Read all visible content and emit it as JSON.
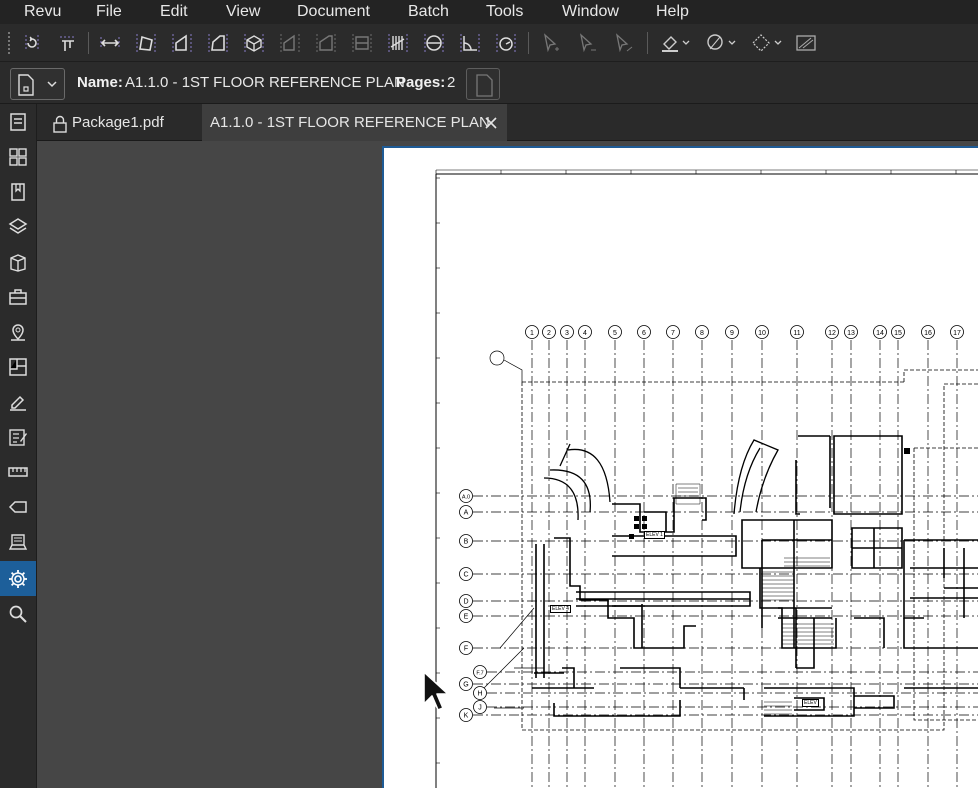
{
  "menu": [
    "Revu",
    "File",
    "Edit",
    "View",
    "Document",
    "Batch",
    "Tools",
    "Window",
    "Help"
  ],
  "toolbar_icons": [
    "rotate-icon",
    "align-icon",
    "length-measure-icon",
    "polylength-icon",
    "area-icon",
    "perimeter-icon",
    "volume-icon",
    "diameter-icon",
    "dynamic-fill-icon",
    "cutout-icon",
    "count-icon",
    "radius-icon",
    "angle-icon",
    "arc-icon",
    "select-markup-icon",
    "line-markup-icon",
    "pen-markup-icon",
    "fill-color-icon",
    "shape-style-icon",
    "hatch-pattern-icon",
    "opacity-icon"
  ],
  "properties": {
    "name_label": "Name:",
    "name_value": "A1.1.0 - 1ST FLOOR REFERENCE PLAN",
    "pages_label": "Pages:",
    "pages_value": "2"
  },
  "tabs": [
    {
      "label": "Package1.pdf",
      "locked": true
    },
    {
      "label": "A1.1.0 - 1ST FLOOR REFERENCE PLAN",
      "closable": true
    }
  ],
  "sidebar_icons": [
    "file-access-icon",
    "thumbnails-icon",
    "bookmarks-icon",
    "layers-icon",
    "spaces-icon",
    "tool-chest-icon",
    "places-icon",
    "sheet-list-icon",
    "signatures-icon",
    "markups-list-icon",
    "measurements-icon",
    "tags-icon",
    "studio-icon",
    "properties-icon",
    "search-icon"
  ],
  "active_sidebar": "properties-icon",
  "drawing": {
    "column_grid": [
      "1",
      "2",
      "3",
      "4",
      "5",
      "6",
      "7",
      "8",
      "9",
      "10",
      "11",
      "12",
      "13",
      "14",
      "15",
      "16",
      "17"
    ],
    "row_grid": [
      "A.0",
      "A",
      "B",
      "C",
      "D",
      "E",
      "F",
      "F.7",
      "G",
      "H",
      "J",
      "K"
    ],
    "room_labels": [
      "ELEV 1",
      "ELEV 4",
      "ELEV"
    ]
  },
  "colors": {
    "accent": "#1d5f9a",
    "menubar": "#232323",
    "toolbar": "#2b2b2b",
    "canvas": "#464646"
  }
}
